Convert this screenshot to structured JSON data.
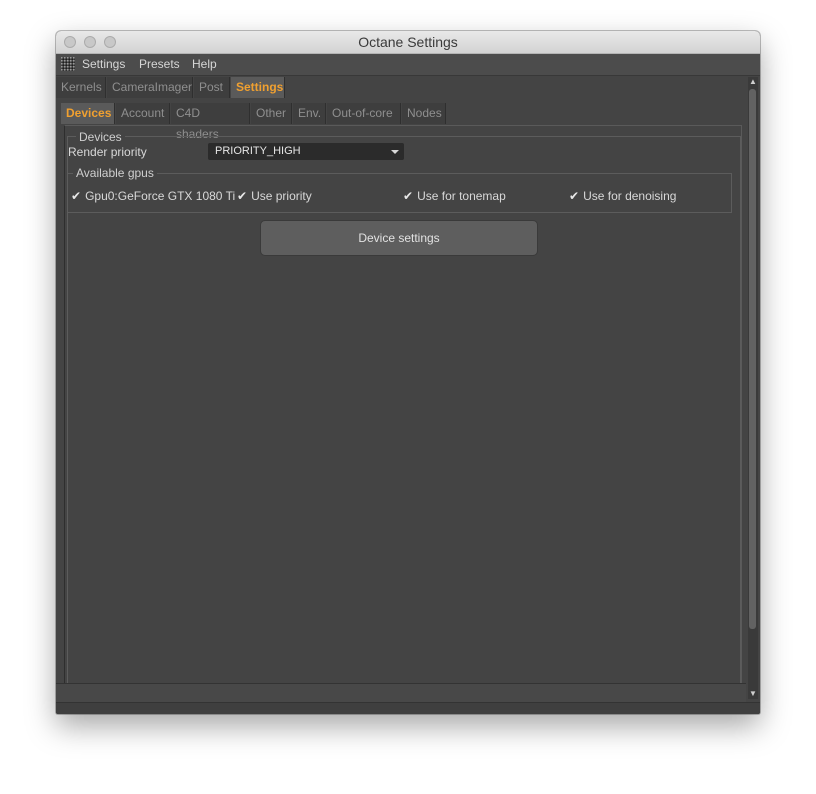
{
  "window": {
    "title": "Octane Settings"
  },
  "menubar": {
    "icon": "grid-grip-icon",
    "items": [
      "Settings",
      "Presets",
      "Help"
    ]
  },
  "main_tabs": [
    {
      "label": "Kernels",
      "active": false
    },
    {
      "label": "CameraImager",
      "active": false
    },
    {
      "label": "Post",
      "active": false
    },
    {
      "label": "Settings",
      "active": true
    }
  ],
  "sub_tabs": [
    {
      "label": "Devices",
      "active": true
    },
    {
      "label": "Account",
      "active": false
    },
    {
      "label": "C4D shaders",
      "active": false
    },
    {
      "label": "Other",
      "active": false
    },
    {
      "label": "Env.",
      "active": false
    },
    {
      "label": "Out-of-core",
      "active": false
    },
    {
      "label": "Nodes",
      "active": false
    }
  ],
  "devices_group": {
    "legend": "Devices",
    "render_priority_label": "Render priority",
    "render_priority_value": "PRIORITY_HIGH",
    "gpus": {
      "legend": "Available gpus",
      "gpu_name": "Gpu0:GeForce GTX 1080 Ti",
      "gpu_checked": true,
      "use_priority": "Use priority",
      "use_priority_checked": true,
      "use_tonemap": "Use for tonemap",
      "use_tonemap_checked": true,
      "use_denoising": "Use for denoising",
      "use_denoising_checked": true
    },
    "device_settings_button": "Device settings"
  },
  "colors": {
    "active_tab_text": "#f0a030",
    "panel_bg": "#444444"
  }
}
